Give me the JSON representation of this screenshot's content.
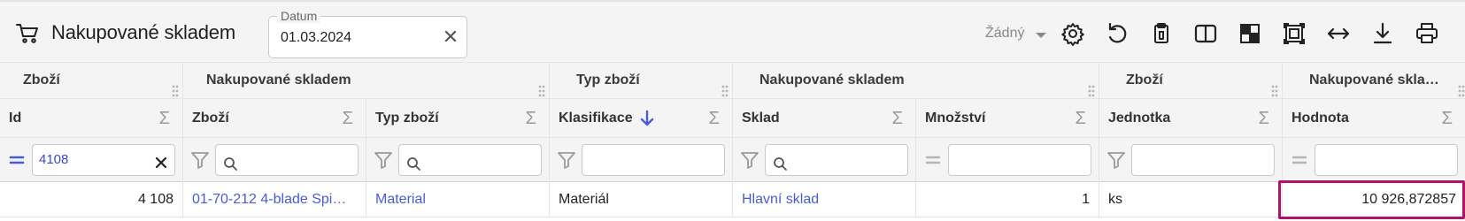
{
  "toolbar": {
    "title": "Nakupované skladem",
    "cart_icon": "shopping-cart-icon",
    "date_field": {
      "label": "Datum",
      "value": "01.03.2024"
    },
    "select_value": "Žádný",
    "icons": [
      "gear-icon",
      "undo-icon",
      "delete-clipboard-icon",
      "split-view-icon",
      "checkerboard-icon",
      "screenshot-frame-icon",
      "horizontal-resize-icon",
      "download-icon",
      "print-icon"
    ]
  },
  "grid": {
    "groups": [
      "Zboží",
      "Nakupované skladem",
      "Typ zboží",
      "Nakupované skladem",
      "Zboží",
      "Nakupované skla…"
    ],
    "columns": [
      {
        "label": "Id",
        "sigma": "Σ"
      },
      {
        "label": "Zboží",
        "sigma": "Σ"
      },
      {
        "label": "Typ zboží",
        "sigma": "Σ"
      },
      {
        "label": "Klasifikace",
        "sigma": "Σ",
        "sorted": "desc"
      },
      {
        "label": "Sklad",
        "sigma": "Σ"
      },
      {
        "label": "Množství",
        "sigma": "Σ"
      },
      {
        "label": "Jednotka",
        "sigma": "Σ"
      },
      {
        "label": "Hodnota",
        "sigma": "Σ"
      }
    ],
    "filters": {
      "id_value": "4108"
    },
    "rows": [
      {
        "id": "4 108",
        "zbozi": "01-70-212 4-blade Spi…",
        "typ": "Material",
        "klasifikace": "Materiál",
        "sklad": "Hlavní sklad",
        "mnozstvi": "1",
        "jednotka": "ks",
        "hodnota": "10 926,872857"
      }
    ]
  },
  "colors": {
    "accent": "#4a5bd6",
    "highlight": "#b0126b",
    "header_bg": "#f4f4f5"
  }
}
